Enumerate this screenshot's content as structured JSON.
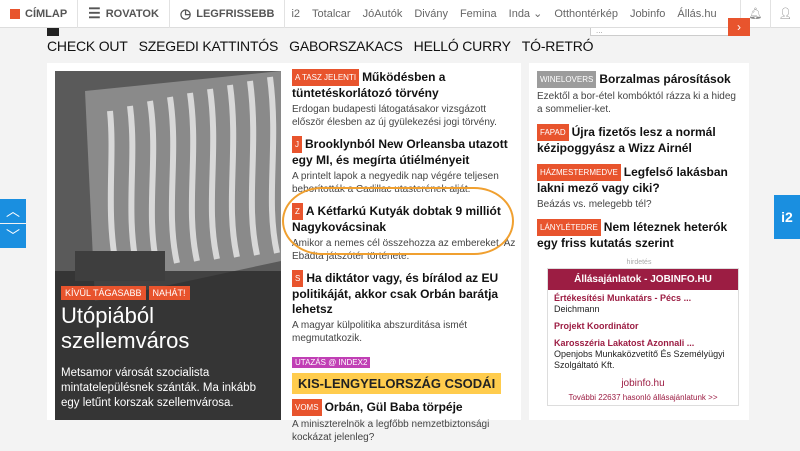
{
  "topbar": {
    "home": "CÍMLAP",
    "sections": "ROVATOK",
    "latest": "LEGFRISSEBB",
    "links": [
      "i2",
      "Totalcar",
      "JóAutók",
      "Divány",
      "Femina",
      "Inda",
      "Otthontérkép",
      "Jobinfo",
      "Állás.hu"
    ]
  },
  "search": {
    "partial": "...",
    "go": "›"
  },
  "categories": [
    "CHECK OUT",
    "SZEGEDI KATTINTÓS",
    "GABORSZAKACS",
    "HELLÓ CURRY",
    "TÓ-RETRÓ"
  ],
  "hero": {
    "tags": [
      "KÍVÜL TÁGASABB",
      "NAHÁT!"
    ],
    "title": "Utópiából szellemváros",
    "lead": "Metsamor városát szocialista mintatelepülésnek szánták. Ma inkább egy letűnt korszak szellemvárosa."
  },
  "articles": [
    {
      "label": "A TASZ JELENTI",
      "title": "Működésben a tüntetéskorlátozó törvény",
      "lead": "Erdogan budapesti látogatásakor vizsgázott először élesben az új gyülekezési jogi törvény."
    },
    {
      "label": "J",
      "title": "Brooklynból New Orleansba utazott egy MI, és megírta útiélményeit",
      "lead": "A printelt lapok a negyedik nap végére teljesen beborították a Cadillac utasterének alját."
    },
    {
      "label": "Z",
      "title": "A Kétfarkú Kutyák dobtak 9 milliót Nagykovácsinak",
      "lead": "Amikor a nemes cél összehozza az embereket. Az Ebadta játszótér története."
    },
    {
      "label": "S",
      "title": "Ha diktátor vagy, és bírálod az EU politikáját, akkor csak Orbán barátja lehetsz",
      "lead": "A magyar külpolitika abszurditása ismét megmutatkozik."
    },
    {
      "label": "VOMS",
      "title": "Orbán, Gül Baba törpéje",
      "lead": "A miniszterelnök a legfőbb nemzetbiztonsági kockázat jelenleg?"
    }
  ],
  "promo": {
    "tag": "UTAZÁS @ INDEX2",
    "title": "KIS-LENGYELORSZÁG CSODÁI"
  },
  "right": {
    "articles": [
      {
        "label": "WINELOVERS",
        "title": "Borzalmas párosítások",
        "lead": "Ezektől a bor-étel kombóktól rázza ki a hideg a sommelier-ket."
      },
      {
        "label": "FAPAD",
        "title": "Újra fizetős lesz a normál kézipoggyász a Wizz Airnél",
        "lead": ""
      },
      {
        "label": "HÁZMESTERMEDVE",
        "title": "Legfelső lakásban lakni mező vagy ciki?",
        "lead": "Beázás vs. melegebb tél?"
      },
      {
        "label": "LÁNYLÉTEDRE",
        "title": "Nem léteznek heterók egy friss kutatás szerint",
        "lead": ""
      }
    ],
    "ad_label": "hirdetés",
    "ad": {
      "header": "Állásajánlatok - JOBINFO.HU",
      "items": [
        {
          "title": "Értékesítési Munkatárs - Pécs ...",
          "company": "Deichmann"
        },
        {
          "title": "Projekt Koordinátor",
          "company": ""
        },
        {
          "title": "Karosszéria Lakatost Azonnali ...",
          "company": "Openjobs Munkaközvetítő És Személyügyi Szolgáltató Kft."
        }
      ],
      "logo": "jobinfo.hu",
      "footer": "További 22637 hasonló állásajánlatunk >>"
    }
  },
  "side": {
    "up": "︿",
    "down": "﹀",
    "i2": "i2"
  }
}
